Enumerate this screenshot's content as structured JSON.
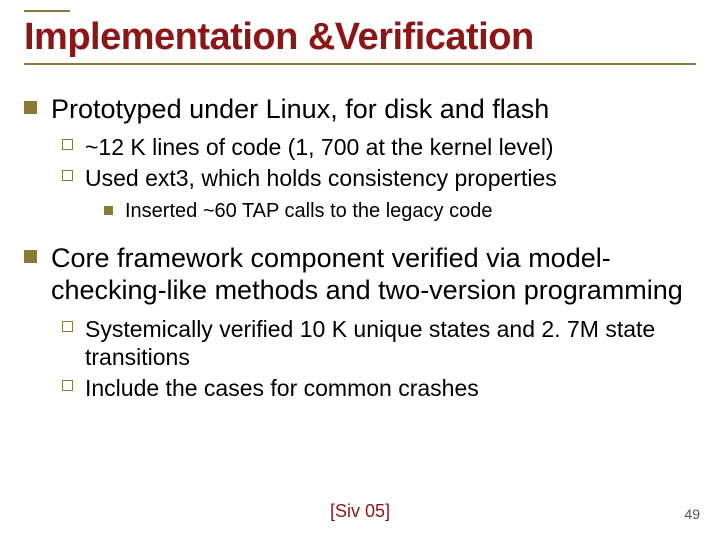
{
  "title": "Implementation &Verification",
  "bullets": [
    {
      "text": "Prototyped under Linux, for disk and flash",
      "children": [
        {
          "text": "~12 K lines of code (1, 700 at the kernel level)"
        },
        {
          "text": "Used ext3, which holds consistency properties",
          "children": [
            {
              "text": "Inserted ~60 TAP calls to the legacy code"
            }
          ]
        }
      ]
    },
    {
      "text": "Core framework component verified via model-checking-like methods and two-version programming",
      "children": [
        {
          "text": "Systemically verified 10 K unique states and 2. 7M state transitions"
        },
        {
          "text": "Include the cases for common crashes"
        }
      ]
    }
  ],
  "citation": "[Siv 05]",
  "page_number": "49"
}
